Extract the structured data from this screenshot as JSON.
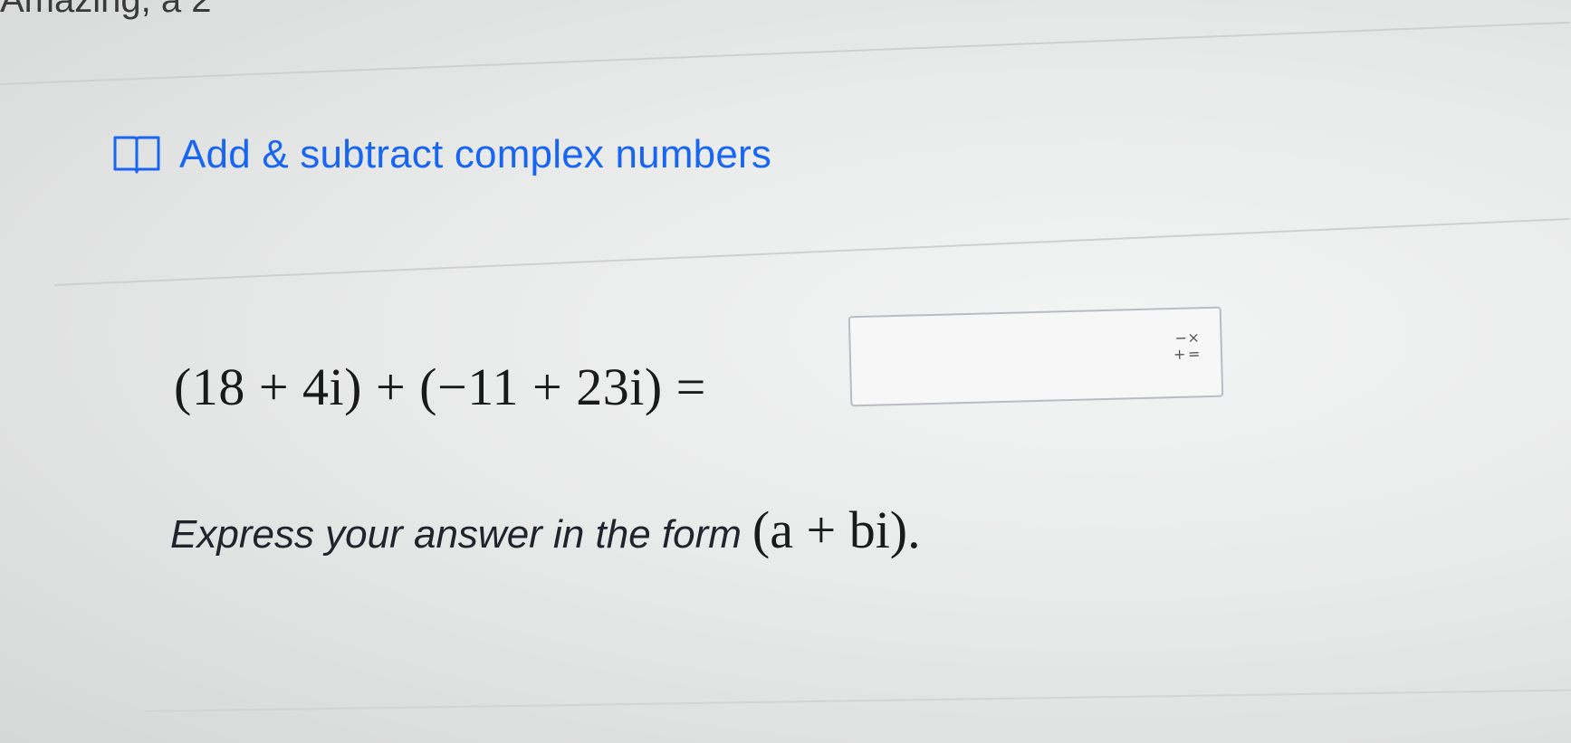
{
  "header": {
    "partial_text": "Amazing, a 2"
  },
  "skill": {
    "icon": "book-icon",
    "title": "Add & subtract complex numbers",
    "title_color": "#1865f2"
  },
  "problem": {
    "equation": "(18 + 4i) + (−11 + 23i) =",
    "answer_value": "",
    "keypad_icon": "math-keypad-icon",
    "keypad_symbols": [
      "−",
      "×",
      "+",
      "="
    ],
    "instruction": "Express your answer in the form",
    "form": "(a + bi)."
  }
}
